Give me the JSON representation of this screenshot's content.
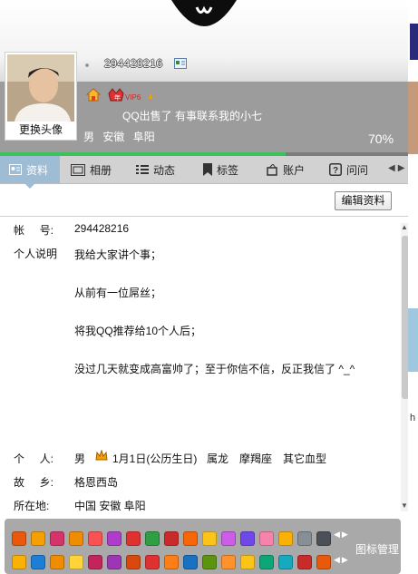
{
  "profile": {
    "qq_number": "294428216",
    "change_avatar_label": "更换头像",
    "vip_label": "VIP6",
    "signature": "QQ出售了 有事联系我的小七",
    "gender": "男",
    "province": "安徽",
    "city": "阜阳",
    "completion": "70%",
    "completion_fraction": 0.7
  },
  "tabs": [
    {
      "label": "资料",
      "icon": "profile-card-icon",
      "active": true
    },
    {
      "label": "相册",
      "icon": "photo-album-icon",
      "active": false
    },
    {
      "label": "动态",
      "icon": "feed-list-icon",
      "active": false
    },
    {
      "label": "标签",
      "icon": "bookmark-icon",
      "active": false
    },
    {
      "label": "账户",
      "icon": "wallet-icon",
      "active": false
    },
    {
      "label": "问问",
      "icon": "question-icon",
      "active": false
    }
  ],
  "edit_button": "编辑资料",
  "details": {
    "account_label": "帐     号:",
    "account_value": "294428216",
    "bio_label": "个人说明",
    "bio_lines": [
      "我给大家讲个事；",
      "从前有一位屌丝；",
      "将我QQ推荐给10个人后；",
      "没过几天就变成高富帅了；至于你信不信，反正我信了 ^_^"
    ],
    "personal_label": "个     人:",
    "personal_gender": "男",
    "birthday": "1月1日(公历生日)",
    "zodiac": "属龙",
    "constellation": "摩羯座",
    "blood_type": "其它血型",
    "hometown_label": "故     乡:",
    "hometown_value": "格恩西岛",
    "location_label": "所在地:",
    "location_value": "中国 安徽 阜阳"
  },
  "icon_manage_label": "图标管理",
  "colors": {
    "banner_bg": "#9c9c9c",
    "tab_bar_bg": "#d2d2d2",
    "active_tab_bg": "#9fbcd5",
    "progress_fill": "#3cc25a",
    "icon_strip_bg": "#a9a9a9"
  },
  "strip_icons": {
    "row1": [
      "heart-badge-icon",
      "diamond-badge-icon",
      "grid-badge-icon",
      "vip-badge-icon",
      "ribbon-badge-icon",
      "gem-badge-icon",
      "red-gem-badge-icon",
      "green-gem-badge-icon",
      "heart-red-badge-icon",
      "book-badge-icon",
      "crown-badge-icon",
      "pink-gem-badge-icon",
      "purple-badge-icon",
      "pink-heart-badge-icon",
      "yellow-badge-icon",
      "gray-gem-badge-icon",
      "dark-badge-icon"
    ],
    "row2": [
      "star-badge-icon",
      "qzone-badge-icon",
      "game-badge-icon",
      "sun-badge-icon",
      "music-badge-icon",
      "purple-swirl-badge-icon",
      "fire-badge-icon",
      "red-card-badge-icon",
      "colorful-badge-icon",
      "sport-badge-icon",
      "blue-badge-icon",
      "orange-badge-icon",
      "gold-badge-icon",
      "teal-badge-icon",
      "cyan-badge-icon",
      "red-badge-icon",
      "pet-badge-icon"
    ]
  }
}
